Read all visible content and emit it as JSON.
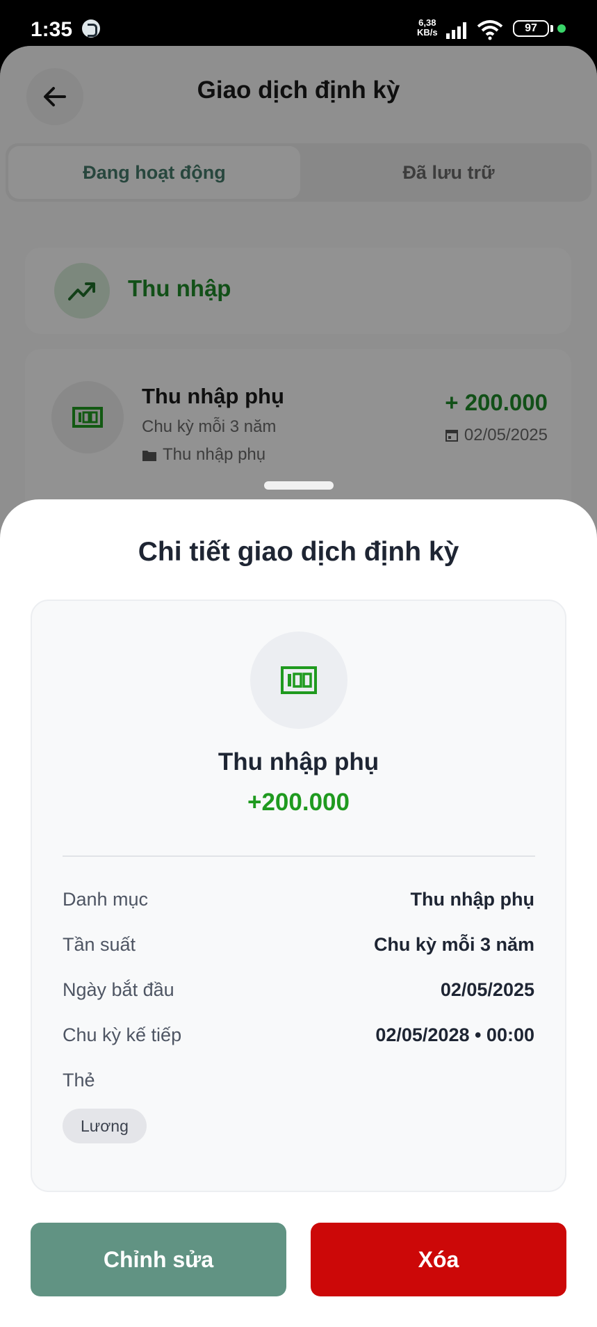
{
  "status_bar": {
    "time": "1:35",
    "net_speed": "6,38",
    "net_unit": "KB/s",
    "battery": "97"
  },
  "header": {
    "title": "Giao dịch định kỳ"
  },
  "tabs": [
    {
      "label": "Đang hoạt động",
      "active": true
    },
    {
      "label": "Đã lưu trữ",
      "active": false
    }
  ],
  "section": {
    "label": "Thu nhập",
    "icon": "trending-up-icon"
  },
  "list_item": {
    "title": "Thu nhập phụ",
    "frequency": "Chu kỳ mỗi 3 năm",
    "category": "Thu nhập phụ",
    "amount": "+ 200.000",
    "date": "02/05/2025",
    "icon": "money-bill-icon"
  },
  "sheet": {
    "title": "Chi tiết giao dịch định kỳ",
    "name": "Thu nhập phụ",
    "amount": "+200.000",
    "rows": [
      {
        "label": "Danh mục",
        "value": "Thu nhập phụ"
      },
      {
        "label": "Tần suất",
        "value": "Chu kỳ mỗi 3 năm"
      },
      {
        "label": "Ngày bắt đầu",
        "value": "02/05/2025"
      },
      {
        "label": "Chu kỳ kế tiếp",
        "value": "02/05/2028 • 00:00"
      }
    ],
    "tags_label": "Thẻ",
    "tags": [
      "Lương"
    ],
    "edit_label": "Chỉnh sửa",
    "delete_label": "Xóa"
  },
  "colors": {
    "income_green": "#1f9a1f",
    "edit_button": "#619383",
    "delete_button": "#cc0808",
    "active_tab_text": "#467a6c"
  }
}
